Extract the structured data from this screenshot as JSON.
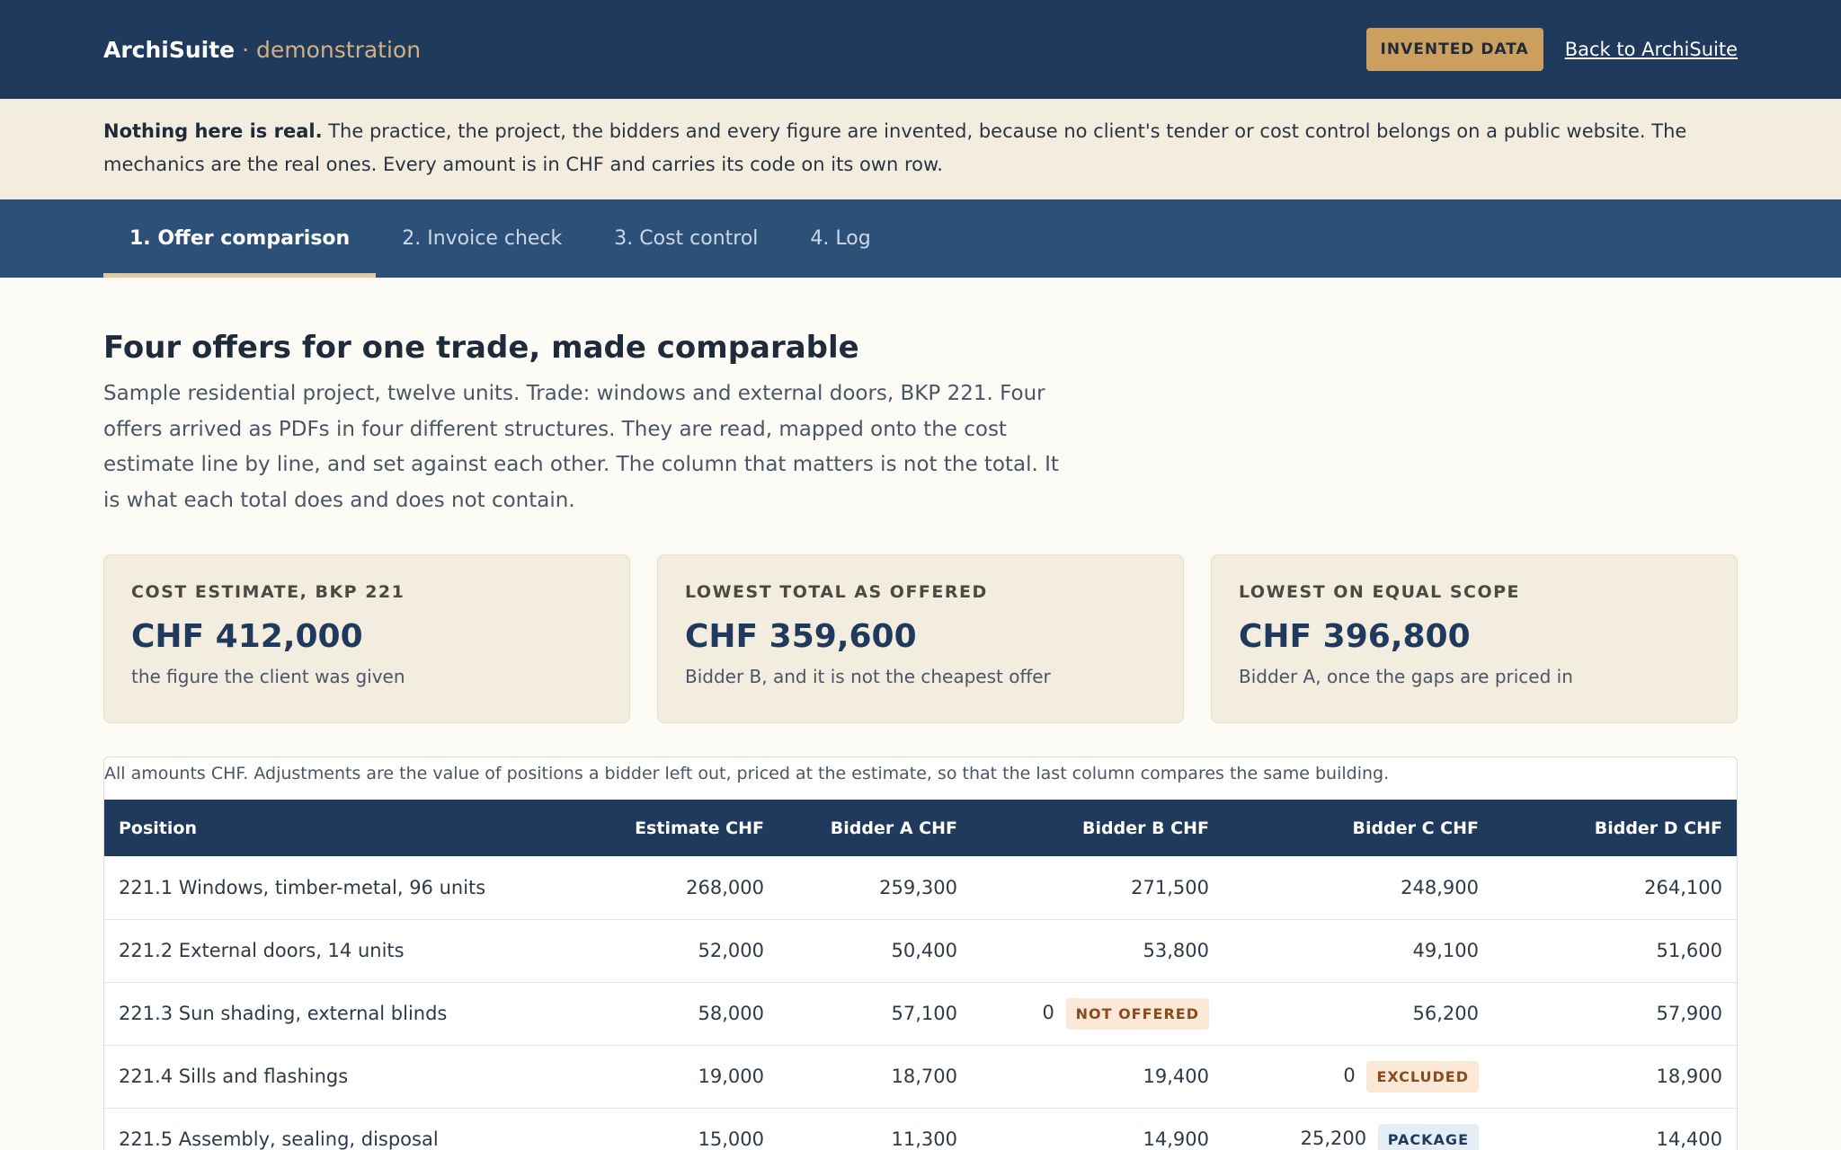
{
  "header": {
    "brand_name": "ArchiSuite",
    "brand_separator": "·",
    "brand_suffix": "demonstration",
    "badge": "INVENTED DATA",
    "back_link": "Back to ArchiSuite"
  },
  "notice": {
    "strong": "Nothing here is real.",
    "text": " The practice, the project, the bidders and every figure are invented, because no client's tender or cost control belongs on a public website. The mechanics are the real ones. Every amount is in CHF and carries its code on its own row."
  },
  "tabs": [
    {
      "label": "1. Offer comparison",
      "active": true
    },
    {
      "label": "2. Invoice check",
      "active": false
    },
    {
      "label": "3. Cost control",
      "active": false
    },
    {
      "label": "4. Log",
      "active": false
    }
  ],
  "main": {
    "title": "Four offers for one trade, made comparable",
    "intro": "Sample residential project, twelve units. Trade: windows and external doors, BKP 221. Four offers arrived as PDFs in four different structures. They are read, mapped onto the cost estimate line by line, and set against each other. The column that matters is not the total. It is what each total does and does not contain."
  },
  "cards": [
    {
      "label": "COST ESTIMATE, BKP 221",
      "value": "CHF 412,000",
      "note": "the figure the client was given"
    },
    {
      "label": "LOWEST TOTAL AS OFFERED",
      "value": "CHF 359,600",
      "note": "Bidder B, and it is not the cheapest offer"
    },
    {
      "label": "LOWEST ON EQUAL SCOPE",
      "value": "CHF 396,800",
      "note": "Bidder A, once the gaps are priced in"
    }
  ],
  "table": {
    "caption": "All amounts CHF. Adjustments are the value of positions a bidder left out, priced at the estimate, so that the last column compares the same building.",
    "headers": [
      "Position",
      "Estimate CHF",
      "Bidder A CHF",
      "Bidder B CHF",
      "Bidder C CHF",
      "Bidder D CHF"
    ],
    "rows": [
      {
        "position": "221.1 Windows, timber-metal, 96 units",
        "estimate": "268,000",
        "a": "259,300",
        "b": "271,500",
        "c": "248,900",
        "d": "264,100"
      },
      {
        "position": "221.2 External doors, 14 units",
        "estimate": "52,000",
        "a": "50,400",
        "b": "53,800",
        "c": "49,100",
        "d": "51,600"
      },
      {
        "position": "221.3 Sun shading, external blinds",
        "estimate": "58,000",
        "a": "57,100",
        "b": "0",
        "b_flag": "NOT OFFERED",
        "c": "56,200",
        "d": "57,900"
      },
      {
        "position": "221.4 Sills and flashings",
        "estimate": "19,000",
        "a": "18,700",
        "b": "19,400",
        "c": "0",
        "c_flag": "EXCLUDED",
        "d": "18,900"
      },
      {
        "position": "221.5 Assembly, sealing, disposal",
        "estimate": "15,000",
        "a": "11,300",
        "b": "14,900",
        "c": "25,200",
        "c_flag": "PACKAGE",
        "d": "14,400"
      }
    ]
  },
  "colors": {
    "header_bg": "#1f3a5c",
    "tabs_bg": "#2d5078",
    "accent_gold": "#cc9f5e",
    "notice_bg": "#f3ede0",
    "page_bg": "#fcfbf6"
  }
}
